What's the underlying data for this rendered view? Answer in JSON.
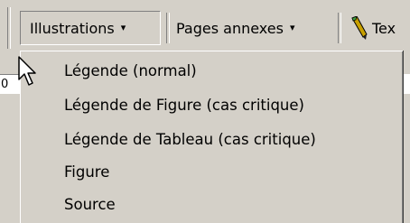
{
  "toolbar": {
    "illustrations_label": "Illustrations",
    "pages_annexes_label": "Pages annexes",
    "texte_label": "Tex",
    "caret": "▾"
  },
  "document": {
    "ruler_text": "0"
  },
  "menu": {
    "items": [
      {
        "label": "Légende (normal)"
      },
      {
        "label": "Légende de Figure (cas critique)"
      },
      {
        "label": "Légende de Tableau (cas critique)"
      },
      {
        "label": "Figure"
      },
      {
        "label": "Source"
      }
    ]
  },
  "icons": {
    "pencil": "pencil-icon",
    "cursor": "mouse-pointer-icon"
  }
}
